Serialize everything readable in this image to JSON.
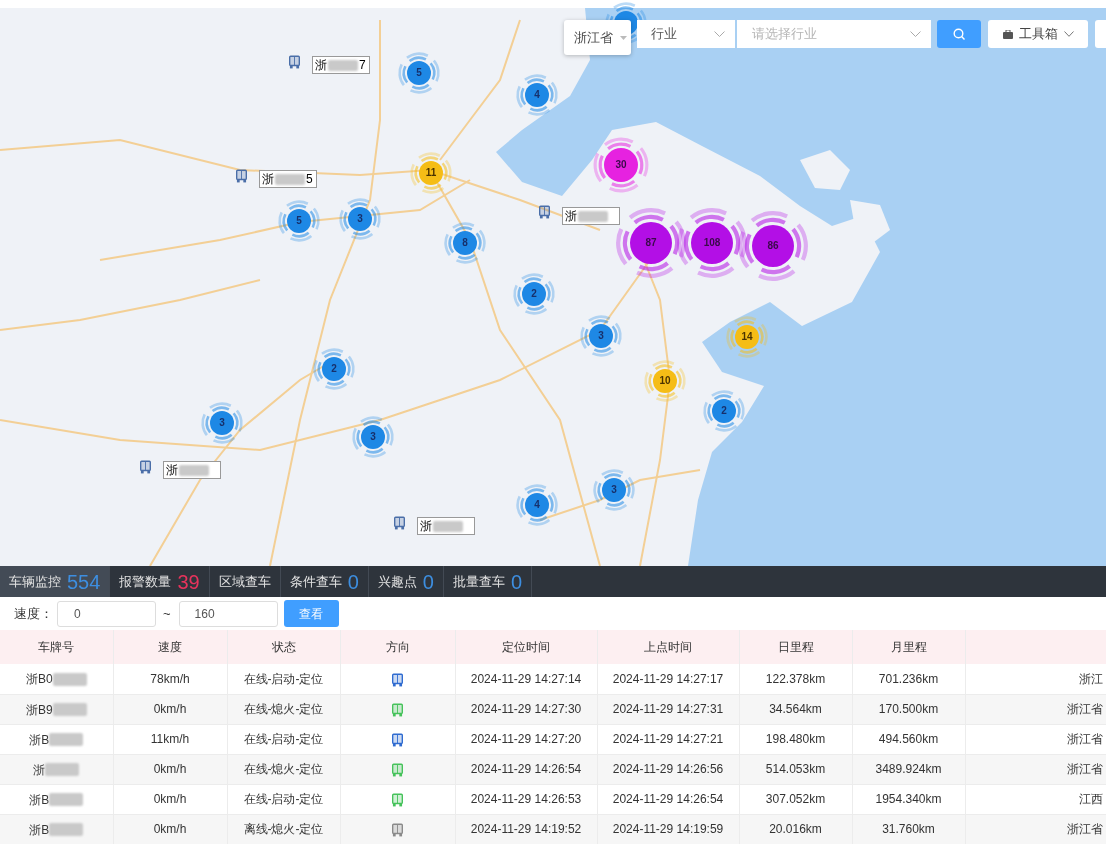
{
  "toolbar": {
    "province": "浙江省",
    "industry": "行业",
    "industry_placeholder": "请选择行业",
    "toolbox": "工具箱"
  },
  "map": {
    "clusters": [
      {
        "kind": "small",
        "color": "#1e88e5"
      },
      {
        "count": "5",
        "kind": "small",
        "color": "#1e88e5"
      },
      {
        "count": "4",
        "kind": "small",
        "color": "#1e88e5"
      },
      {
        "count": "11",
        "kind": "small",
        "color": "#f5bd16"
      },
      {
        "count": "30",
        "kind": "medium",
        "color": "#e622e0"
      },
      {
        "count": "5",
        "kind": "small",
        "color": "#1e88e5"
      },
      {
        "count": "3",
        "kind": "small",
        "color": "#1e88e5"
      },
      {
        "count": "8",
        "kind": "small",
        "color": "#1e88e5"
      },
      {
        "count": "87",
        "kind": "large",
        "color": "#b30fe6"
      },
      {
        "count": "108",
        "kind": "large",
        "color": "#b30fe6"
      },
      {
        "count": "86",
        "kind": "large",
        "color": "#b30fe6"
      },
      {
        "count": "2",
        "kind": "small",
        "color": "#1e88e5"
      },
      {
        "count": "3",
        "kind": "small",
        "color": "#1e88e5"
      },
      {
        "count": "14",
        "kind": "small",
        "color": "#f5bd16"
      },
      {
        "count": "2",
        "kind": "small",
        "color": "#1e88e5"
      },
      {
        "count": "10",
        "kind": "small",
        "color": "#f5bd16"
      },
      {
        "count": "3",
        "kind": "small",
        "color": "#1e88e5"
      },
      {
        "count": "3",
        "kind": "small",
        "color": "#1e88e5"
      },
      {
        "count": "2",
        "kind": "small",
        "color": "#1e88e5"
      },
      {
        "count": "4",
        "kind": "small",
        "color": "#1e88e5"
      },
      {
        "count": "3",
        "kind": "small",
        "color": "#1e88e5"
      }
    ],
    "vehicles": [
      {
        "plate": "浙",
        "suffix": "7"
      },
      {
        "plate": "浙",
        "suffix": "5"
      },
      {
        "plate": "浙"
      },
      {
        "plate": "浙"
      },
      {
        "plate": "浙"
      }
    ]
  },
  "tabs": [
    {
      "label": "车辆监控",
      "count": "554",
      "color": "#3d8ee0",
      "selected": true
    },
    {
      "label": "报警数量",
      "count": "39",
      "color": "#e8335c",
      "selected": false
    },
    {
      "label": "区域查车",
      "selected": false
    },
    {
      "label": "条件查车",
      "count": "0",
      "color": "#3d8ee0",
      "selected": false
    },
    {
      "label": "兴趣点",
      "count": "0",
      "color": "#3d8ee0",
      "selected": false
    },
    {
      "label": "批量查车",
      "count": "0",
      "color": "#3d8ee0",
      "selected": false
    }
  ],
  "filter": {
    "label": "速度：",
    "min": "0",
    "separator": "~",
    "max": "160",
    "button": "查看"
  },
  "table": {
    "columns": [
      "车牌号",
      "速度",
      "状态",
      "方向",
      "定位时间",
      "上点时间",
      "日里程",
      "月里程"
    ],
    "rows": [
      {
        "plate": "浙B0",
        "speed": "78km/h",
        "status": "在线-启动-定位",
        "color": "#2f6bd0",
        "located_at": "2024-11-29 14:27:14",
        "reported_at": "2024-11-29 14:27:17",
        "daily_mileage": "122.378km",
        "monthly_mileage": "701.236km",
        "column_9": "浙江"
      },
      {
        "plate": "浙B9",
        "speed": "0km/h",
        "status": "在线-熄火-定位",
        "color": "#45c25a",
        "located_at": "2024-11-29 14:27:30",
        "reported_at": "2024-11-29 14:27:31",
        "daily_mileage": "34.564km",
        "monthly_mileage": "170.500km",
        "column_9": "浙江省"
      },
      {
        "plate": "浙B",
        "speed": "11km/h",
        "status": "在线-启动-定位",
        "color": "#2f6bd0",
        "located_at": "2024-11-29 14:27:20",
        "reported_at": "2024-11-29 14:27:21",
        "daily_mileage": "198.480km",
        "monthly_mileage": "494.560km",
        "column_9": "浙江省"
      },
      {
        "plate": "浙",
        "speed": "0km/h",
        "status": "在线-熄火-定位",
        "color": "#45c25a",
        "located_at": "2024-11-29 14:26:54",
        "reported_at": "2024-11-29 14:26:56",
        "daily_mileage": "514.053km",
        "monthly_mileage": "3489.924km",
        "column_9": "浙江省"
      },
      {
        "plate": "浙B",
        "speed": "0km/h",
        "status": "在线-启动-定位",
        "color": "#45c25a",
        "located_at": "2024-11-29 14:26:53",
        "reported_at": "2024-11-29 14:26:54",
        "daily_mileage": "307.052km",
        "monthly_mileage": "1954.340km",
        "column_9": "江西"
      },
      {
        "plate": "浙B",
        "speed": "0km/h",
        "status": "离线-熄火-定位",
        "color": "#8a8a8a",
        "located_at": "2024-11-29 14:19:52",
        "reported_at": "2024-11-29 14:19:59",
        "daily_mileage": "20.016km",
        "monthly_mileage": "31.760km",
        "column_9": "浙江省"
      }
    ]
  }
}
